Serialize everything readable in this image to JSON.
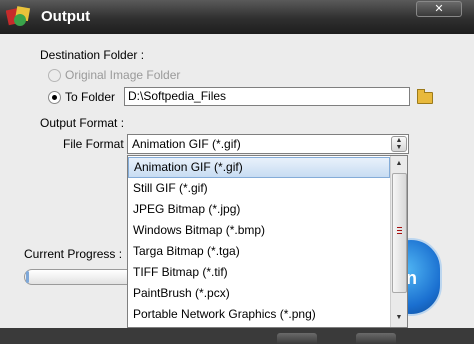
{
  "window": {
    "title": "Output",
    "close_label": "✕"
  },
  "destination": {
    "section_label": "Destination Folder :",
    "original_option_label": "Original Image Folder",
    "folder_option_label": "To Folder",
    "folder_path": "D:\\Softpedia_Files",
    "selected_option": "To Folder"
  },
  "output_format": {
    "section_label": "Output Format :",
    "file_format_label": "File Format",
    "selected_value": "Animation GIF (*.gif)",
    "options": [
      "Animation GIF (*.gif)",
      "Still GIF (*.gif)",
      "JPEG Bitmap (*.jpg)",
      "Windows Bitmap (*.bmp)",
      "Targa Bitmap (*.tga)",
      "TIFF Bitmap (*.tif)",
      "PaintBrush (*.pcx)",
      "Portable Network Graphics (*.png)"
    ]
  },
  "progress": {
    "label": "Current Progress :",
    "value": 0.005
  },
  "colors": {
    "titlebar": "#2f2f2f",
    "body": "#ececec",
    "selection": "#c7dcf2",
    "accent_button": "#1a6fd0"
  },
  "icons": {
    "app": "app-logo-icon",
    "browse": "folder-icon",
    "dropdown": "chevron-down-icon"
  }
}
